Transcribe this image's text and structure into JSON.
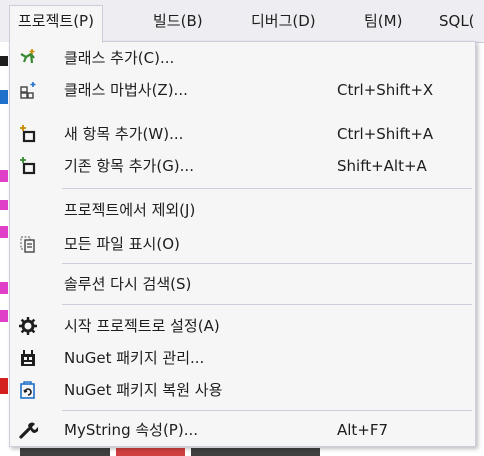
{
  "menubar": {
    "items": [
      "프로젝트(P)",
      "빌드(B)",
      "디버그(D)",
      "팀(M)",
      "SQL("
    ]
  },
  "dropdown": {
    "items": [
      {
        "icon": "class-add-icon",
        "label": "클래스 추가(C)...",
        "shortcut": ""
      },
      {
        "icon": "class-wizard-icon",
        "label": "클래스 마법사(Z)...",
        "shortcut": "Ctrl+Shift+X"
      },
      {
        "icon": "new-item-icon",
        "label": "새 항목 추가(W)...",
        "shortcut": "Ctrl+Shift+A"
      },
      {
        "icon": "existing-item-icon",
        "label": "기존 항목 추가(G)...",
        "shortcut": "Shift+Alt+A"
      },
      {
        "icon": "",
        "label": "프로젝트에서 제외(J)",
        "shortcut": ""
      },
      {
        "icon": "show-all-files-icon",
        "label": "모든 파일 표시(O)",
        "shortcut": ""
      },
      {
        "icon": "",
        "label": "솔루션 다시 검색(S)",
        "shortcut": ""
      },
      {
        "icon": "gear-icon",
        "label": "시작 프로젝트로 설정(A)",
        "shortcut": ""
      },
      {
        "icon": "nuget-icon",
        "label": "NuGet 패키지 관리...",
        "shortcut": ""
      },
      {
        "icon": "nuget-restore-icon",
        "label": "NuGet 패키지 복원 사용",
        "shortcut": ""
      },
      {
        "icon": "wrench-icon",
        "label": "MyString 속성(P)...",
        "shortcut": "Alt+F7"
      }
    ]
  },
  "colors": {
    "menu_bg": "#f6f6f6",
    "menubar_bg": "#eeeef2",
    "border": "#cccedb",
    "accent_green": "#388a34",
    "accent_blue": "#1e70c8",
    "accent_orange": "#c98a00"
  }
}
